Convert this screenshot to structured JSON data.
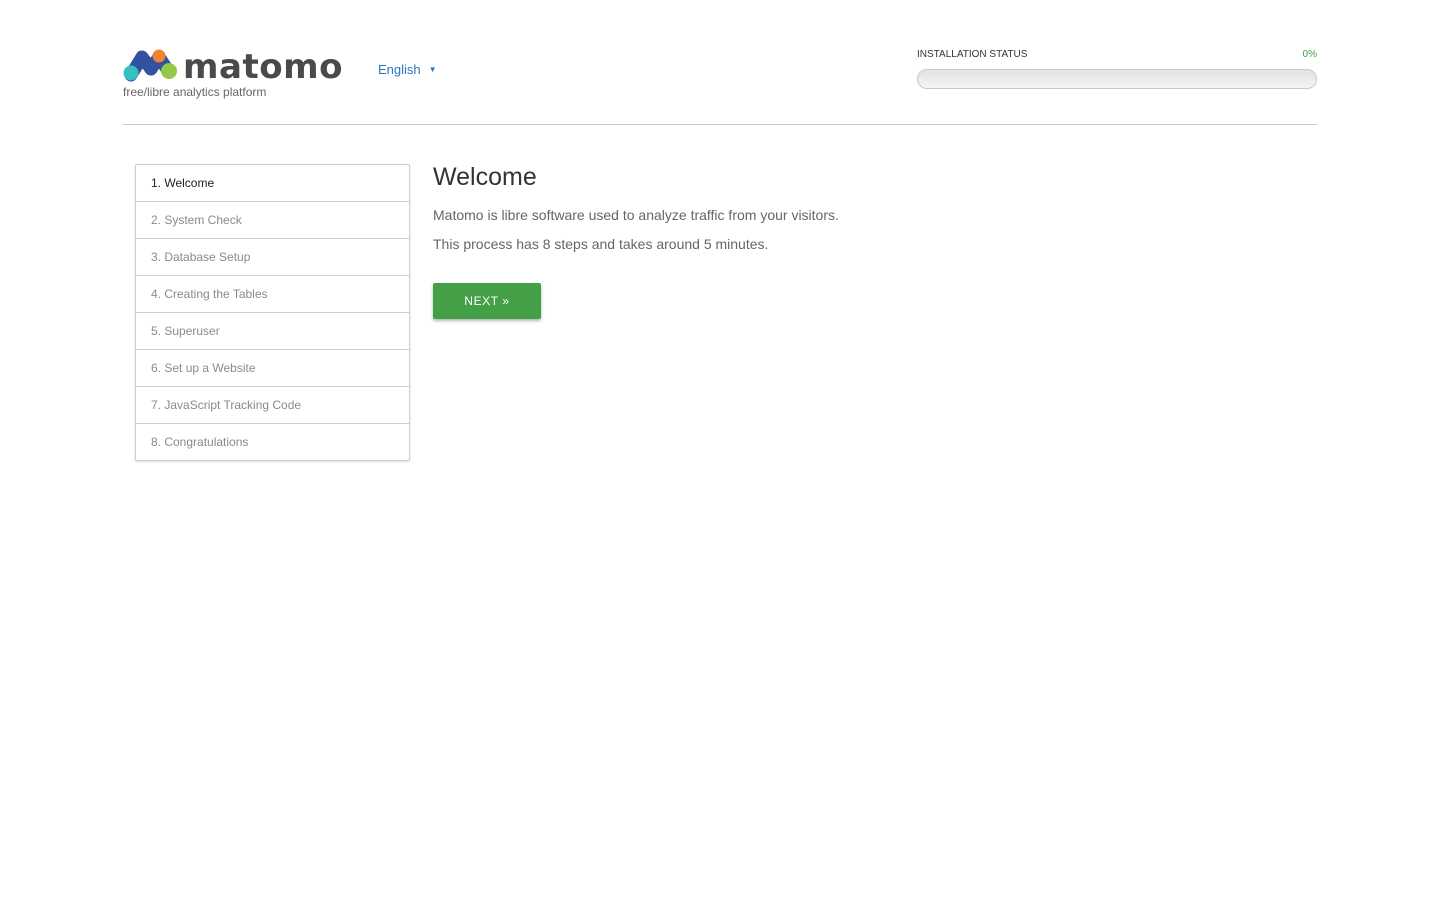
{
  "header": {
    "logo_text": "matomo",
    "tagline": "free/libre analytics platform",
    "language": "English",
    "language_caret": "▼"
  },
  "status": {
    "label": "INSTALLATION STATUS",
    "percent_text": "0%",
    "progress": 0,
    "accent_color": "#43a047"
  },
  "steps": [
    {
      "label": "1. Welcome",
      "active": true
    },
    {
      "label": "2. System Check",
      "active": false
    },
    {
      "label": "3. Database Setup",
      "active": false
    },
    {
      "label": "4. Creating the Tables",
      "active": false
    },
    {
      "label": "5. Superuser",
      "active": false
    },
    {
      "label": "6. Set up a Website",
      "active": false
    },
    {
      "label": "7. JavaScript Tracking Code",
      "active": false
    },
    {
      "label": "8. Congratulations",
      "active": false
    }
  ],
  "main": {
    "title": "Welcome",
    "paragraph1": "Matomo is libre software used to analyze traffic from your visitors.",
    "paragraph2": "This process has 8 steps and takes around 5 minutes.",
    "next_label": "NEXT »"
  },
  "colors": {
    "brand_blue": "#3152a0",
    "brand_green": "#95c748",
    "brand_orange": "#f38334",
    "brand_teal": "#35bfc0",
    "link_blue": "#2f74c0",
    "button_green": "#43a047"
  }
}
